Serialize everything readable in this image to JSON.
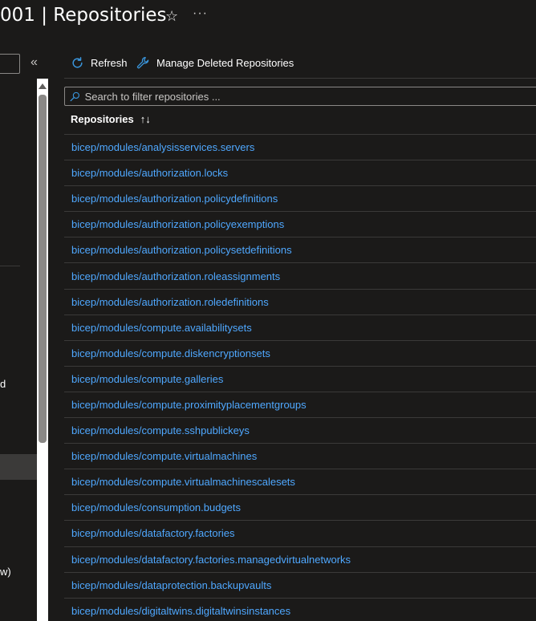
{
  "page": {
    "title": "001 | Repositories"
  },
  "left": {
    "text_d": "d",
    "text_w": "w)"
  },
  "toolbar": {
    "refresh_label": "Refresh",
    "manage_deleted_label": "Manage Deleted Repositories"
  },
  "search": {
    "placeholder": "Search to filter repositories ..."
  },
  "table": {
    "header": "Repositories",
    "sort_icon": "↑↓",
    "rows": [
      "bicep/modules/analysisservices.servers",
      "bicep/modules/authorization.locks",
      "bicep/modules/authorization.policydefinitions",
      "bicep/modules/authorization.policyexemptions",
      "bicep/modules/authorization.policysetdefinitions",
      "bicep/modules/authorization.roleassignments",
      "bicep/modules/authorization.roledefinitions",
      "bicep/modules/compute.availabilitysets",
      "bicep/modules/compute.diskencryptionsets",
      "bicep/modules/compute.galleries",
      "bicep/modules/compute.proximityplacementgroups",
      "bicep/modules/compute.sshpublickeys",
      "bicep/modules/compute.virtualmachines",
      "bicep/modules/compute.virtualmachinescalesets",
      "bicep/modules/consumption.budgets",
      "bicep/modules/datafactory.factories",
      "bicep/modules/datafactory.factories.managedvirtualnetworks",
      "bicep/modules/dataprotection.backupvaults",
      "bicep/modules/digitaltwins.digitaltwinsinstances"
    ]
  },
  "icons": {
    "favorite": "star-icon",
    "more": "more-icon",
    "collapse": "double-chevron-left-icon",
    "refresh": "refresh-icon",
    "manage": "wrench-icon",
    "search": "search-icon",
    "sort": "sort-icon"
  },
  "colors": {
    "background": "#1b1a19",
    "link": "#4fa8ff",
    "divider": "#3b3a39",
    "accent": "#4fa8ff"
  }
}
